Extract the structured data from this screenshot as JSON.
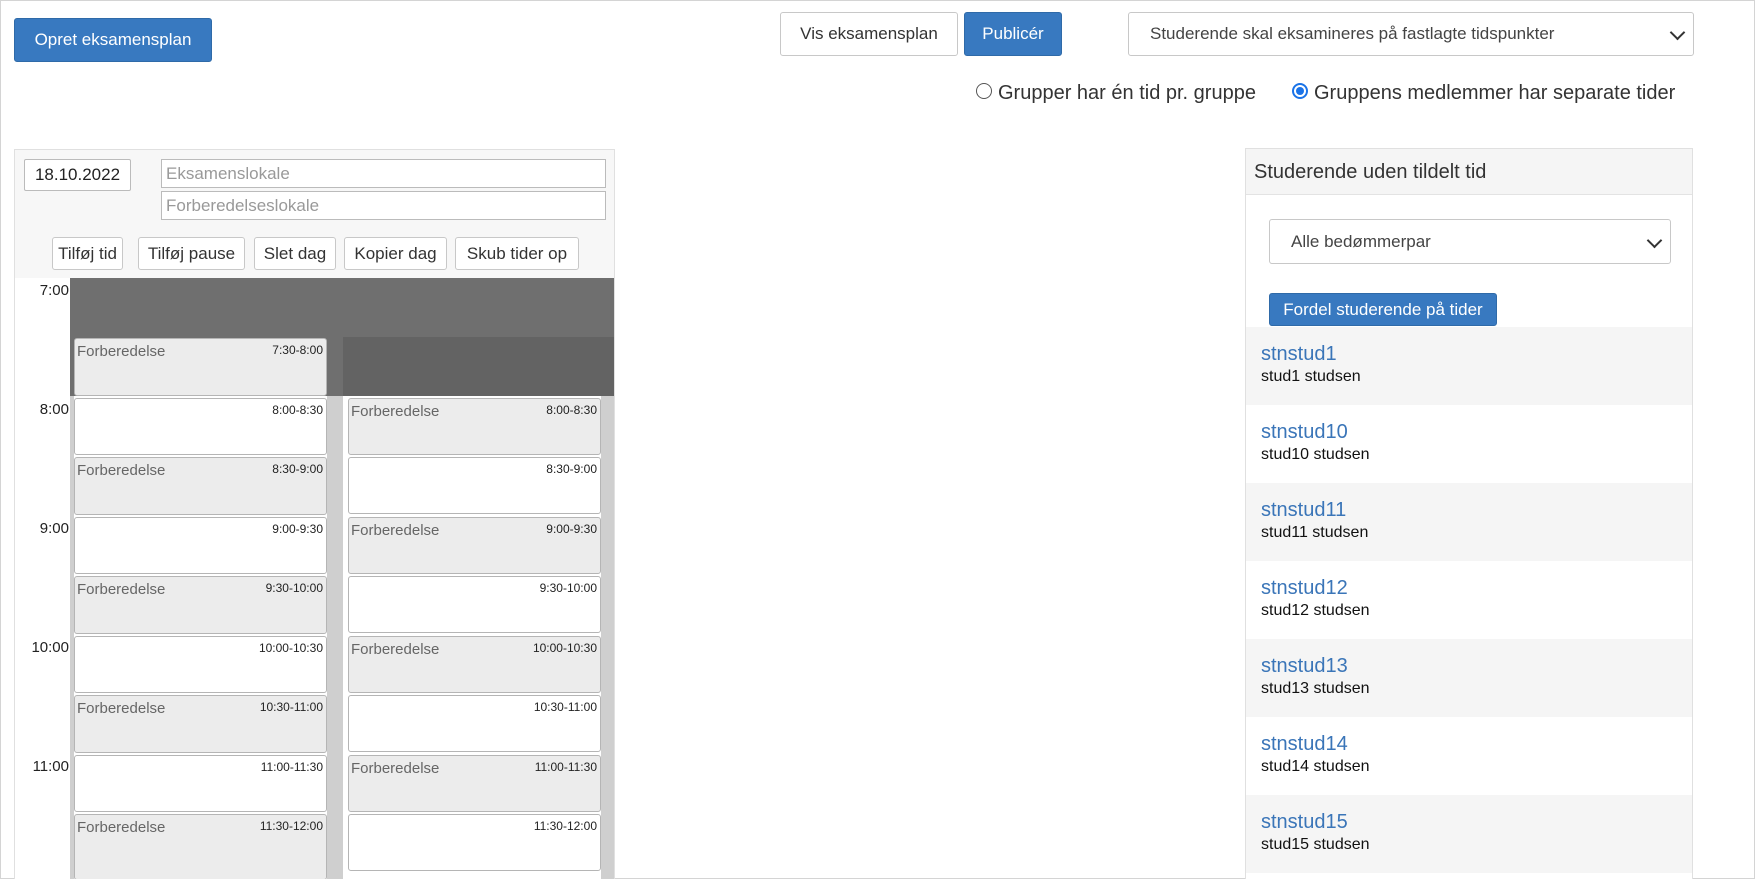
{
  "header": {
    "create_label": "Opret eksamensplan",
    "show_label": "Vis eksamensplan",
    "publish_label": "Publicér",
    "mode_select": "Studerende skal eksamineres på fastlagte tidspunkter",
    "radio_group_one": "Grupper har én tid pr. gruppe",
    "radio_group_separate": "Gruppens medlemmer har separate tider",
    "radio_selected": "separate"
  },
  "calendar": {
    "date": "18.10.2022",
    "room_placeholder": "Eksamenslokale",
    "prep_room_placeholder": "Forberedelseslokale",
    "buttons": {
      "add_time": "Tilføj tid",
      "add_break": "Tilføj pause",
      "delete_day": "Slet dag",
      "copy_day": "Kopier dag",
      "push_times": "Skub tider op"
    },
    "hours": [
      "7:00",
      "8:00",
      "9:00",
      "10:00",
      "11:00"
    ],
    "columns": [
      {
        "slots": [
          {
            "kind": "prep",
            "label": "Forberedelse",
            "time": "7:30-8:00"
          },
          {
            "kind": "exam",
            "label": "",
            "time": "8:00-8:30"
          },
          {
            "kind": "prep",
            "label": "Forberedelse",
            "time": "8:30-9:00"
          },
          {
            "kind": "exam",
            "label": "",
            "time": "9:00-9:30"
          },
          {
            "kind": "prep",
            "label": "Forberedelse",
            "time": "9:30-10:00"
          },
          {
            "kind": "exam",
            "label": "",
            "time": "10:00-10:30"
          },
          {
            "kind": "prep",
            "label": "Forberedelse",
            "time": "10:30-11:00"
          },
          {
            "kind": "exam",
            "label": "",
            "time": "11:00-11:30"
          },
          {
            "kind": "prep",
            "label": "Forberedelse",
            "time": "11:30-12:00"
          }
        ]
      },
      {
        "slots": [
          {
            "kind": "prep",
            "label": "Forberedelse",
            "time": "8:00-8:30"
          },
          {
            "kind": "exam",
            "label": "",
            "time": "8:30-9:00"
          },
          {
            "kind": "prep",
            "label": "Forberedelse",
            "time": "9:00-9:30"
          },
          {
            "kind": "exam",
            "label": "",
            "time": "9:30-10:00"
          },
          {
            "kind": "prep",
            "label": "Forberedelse",
            "time": "10:00-10:30"
          },
          {
            "kind": "exam",
            "label": "",
            "time": "10:30-11:00"
          },
          {
            "kind": "prep",
            "label": "Forberedelse",
            "time": "11:00-11:30"
          },
          {
            "kind": "exam",
            "label": "",
            "time": "11:30-12:00"
          }
        ]
      }
    ]
  },
  "side": {
    "title": "Studerende uden tildelt tid",
    "assessor_select": "Alle bedømmerpar",
    "distribute_label": "Fordel studerende på tider",
    "students": [
      {
        "username": "stnstud1",
        "name": "stud1 studsen"
      },
      {
        "username": "stnstud10",
        "name": "stud10 studsen"
      },
      {
        "username": "stnstud11",
        "name": "stud11 studsen"
      },
      {
        "username": "stnstud12",
        "name": "stud12 studsen"
      },
      {
        "username": "stnstud13",
        "name": "stud13 studsen"
      },
      {
        "username": "stnstud14",
        "name": "stud14 studsen"
      },
      {
        "username": "stnstud15",
        "name": "stud15 studsen"
      }
    ]
  },
  "colors": {
    "primary": "#3879c0",
    "link": "#3a75b8",
    "closed_dark": "#6f6f6f",
    "closed_darker": "#636363",
    "column_gutter": "#cfcfcf",
    "prep_fill": "#ececec"
  }
}
